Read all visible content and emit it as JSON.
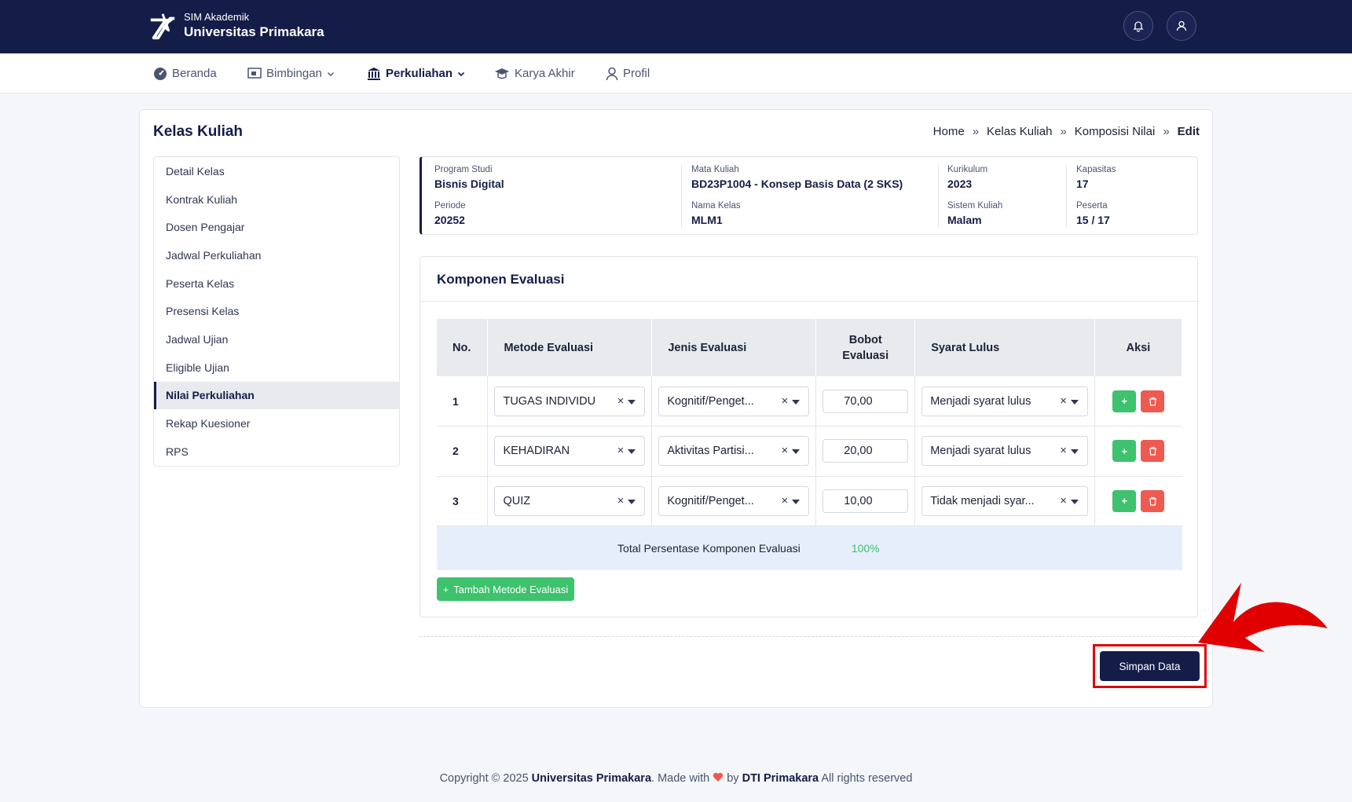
{
  "app": {
    "subtitle": "SIM Akademik",
    "name": "Universitas Primakara"
  },
  "nav": [
    {
      "label": "Beranda",
      "icon": "dashboard-icon"
    },
    {
      "label": "Bimbingan",
      "icon": "classroom-icon"
    },
    {
      "label": "Perkuliahan",
      "icon": "institution-icon",
      "active": true
    },
    {
      "label": "Karya Akhir",
      "icon": "graduation-cap-icon"
    },
    {
      "label": "Profil",
      "icon": "user-icon"
    }
  ],
  "page": {
    "title": "Kelas Kuliah",
    "breadcrumb": [
      "Home",
      "Kelas Kuliah",
      "Komposisi Nilai",
      "Edit"
    ],
    "breadcrumb_sep": "»"
  },
  "sidebar": [
    "Detail Kelas",
    "Kontrak Kuliah",
    "Dosen Pengajar",
    "Jadwal Perkuliahan",
    "Peserta Kelas",
    "Presensi Kelas",
    "Jadwal Ujian",
    "Eligible Ujian",
    "Nilai Perkuliahan",
    "Rekap Kuesioner",
    "RPS"
  ],
  "sidebar_active": "Nilai Perkuliahan",
  "info": {
    "program_studi": {
      "label": "Program Studi",
      "value": "Bisnis Digital"
    },
    "mata_kuliah": {
      "label": "Mata Kuliah",
      "value": "BD23P1004 - Konsep Basis Data (2 SKS)"
    },
    "kurikulum": {
      "label": "Kurikulum",
      "value": "2023"
    },
    "kapasitas": {
      "label": "Kapasitas",
      "value": "17"
    },
    "periode": {
      "label": "Periode",
      "value": "20252"
    },
    "nama_kelas": {
      "label": "Nama Kelas",
      "value": "MLM1"
    },
    "sistem_kuliah": {
      "label": "Sistem Kuliah",
      "value": "Malam"
    },
    "peserta": {
      "label": "Peserta",
      "value": "15 / 17"
    }
  },
  "komponen": {
    "title": "Komponen Evaluasi",
    "headers": {
      "no": "No.",
      "metode": "Metode Evaluasi",
      "jenis": "Jenis Evaluasi",
      "bobot_1": "Bobot",
      "bobot_2": "Evaluasi",
      "syarat": "Syarat Lulus",
      "aksi": "Aksi"
    },
    "rows": [
      {
        "no": "1",
        "metode": "TUGAS INDIVIDU",
        "jenis": "Kognitif/Penget...",
        "bobot": "70,00",
        "syarat": "Menjadi syarat lulus"
      },
      {
        "no": "2",
        "metode": "KEHADIRAN",
        "jenis": "Aktivitas Partisi...",
        "bobot": "20,00",
        "syarat": "Menjadi syarat lulus"
      },
      {
        "no": "3",
        "metode": "QUIZ",
        "jenis": "Kognitif/Penget...",
        "bobot": "10,00",
        "syarat": "Tidak menjadi syar..."
      }
    ],
    "total_label": "Total Persentase Komponen Evaluasi",
    "total_value": "100%",
    "add_method": "Tambah Metode Evaluasi",
    "clear_glyph": "×",
    "add_glyph": "+"
  },
  "save_button": "Simpan Data",
  "footer": {
    "copyright": "Copyright © 2025",
    "org": "Universitas Primakara",
    "made_with": ". Made with",
    "by": "by",
    "team": "DTI Primakara",
    "rights": "All rights reserved"
  },
  "colors": {
    "navy": "#141d48",
    "green": "#3ec26d",
    "red": "#ef5a50",
    "highlight": "#e00000"
  }
}
